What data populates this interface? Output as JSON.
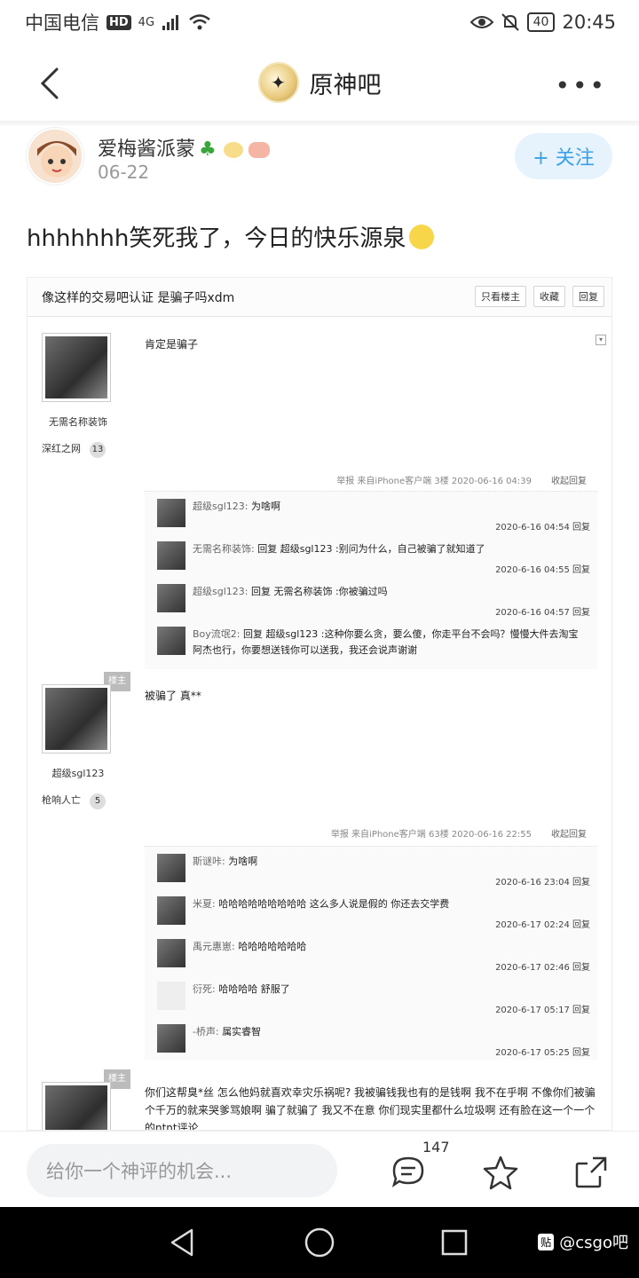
{
  "status_bar": {
    "carrier": "中国电信",
    "hd": "HD",
    "network": "4G",
    "battery": "40",
    "time": "20:45"
  },
  "nav": {
    "forum_name": "原神吧"
  },
  "post": {
    "author_name": "爱梅酱派蒙",
    "date": "06-22",
    "follow_label": "+ 关注",
    "text": "hhhhhhh笑死我了，今日的快乐源泉"
  },
  "screenshot": {
    "title": "像这样的交易吧认证 是骗子吗xdm",
    "buttons": [
      "只看楼主",
      "收藏",
      "回复"
    ],
    "floor1": {
      "user": "无需名称装饰",
      "badge": "深红之网",
      "level": "13",
      "content": "肯定是骗子",
      "meta": "举报  来自iPhone客户端  3楼  2020-06-16 04:39",
      "reply_action": "收起回复",
      "replies": [
        {
          "user": "超级sgl123:",
          "text": "为啥啊",
          "time": "2020-6-16 04:54  回复"
        },
        {
          "user": "无需名称装饰:",
          "text": "回复 超级sgl123 :别问为什么，自己被骗了就知道了",
          "time": "2020-6-16 04:55  回复"
        },
        {
          "user": "超级sgl123:",
          "text": "回复 无需名称装饰 :你被骗过吗",
          "time": "2020-6-16 04:57  回复"
        },
        {
          "user": "Boy流氓2:",
          "text": "回复 超级sgl123 :这种你要么贪，要么傻，你走平台不会吗？慢慢大件去淘宝阿杰也行，你要想送钱你可以送我，我还会说声谢谢",
          "time": ""
        }
      ]
    },
    "floor2": {
      "tag": "楼主",
      "user": "超级sgl123",
      "badge": "枪响人亡",
      "level": "5",
      "content": "被骗了 真**",
      "meta": "举报  来自iPhone客户端  63楼  2020-06-16 22:55",
      "reply_action": "收起回复",
      "replies": [
        {
          "user": "斯谜咔:",
          "text": "为啥啊",
          "time": "2020-6-16 23:04  回复"
        },
        {
          "user": "米夏:",
          "text": "哈哈哈哈哈哈哈哈哈 这么多人说是假的 你还去交学费",
          "time": "2020-6-17 02:24  回复"
        },
        {
          "user": "禹元惠崽:",
          "text": "哈哈哈哈哈哈哈",
          "time": "2020-6-17 02:46  回复"
        },
        {
          "user": "衍死:",
          "text": "哈哈哈哈 舒服了",
          "time": "2020-6-17 05:17  回复"
        },
        {
          "user": "-桥声:",
          "text": "属实睿智",
          "time": "2020-6-17 05:25  回复"
        }
      ]
    },
    "floor3": {
      "tag": "楼主",
      "content": "你们这帮臭*丝 怎么他妈就喜欢幸灾乐祸呢? 我被骗钱我也有的是钱啊 我不在乎啊 不像你们被骗个千万的就来哭爹骂娘啊 骗了就骗了 我又不在意 你们现实里都什么垃圾啊 还有脸在这一个一个的ntnt评论"
    }
  },
  "bottom_bar": {
    "input_placeholder": "给你一个神评的机会...",
    "comment_count": "147"
  },
  "watermark": {
    "logo": "贴",
    "text": "@csgo吧"
  }
}
